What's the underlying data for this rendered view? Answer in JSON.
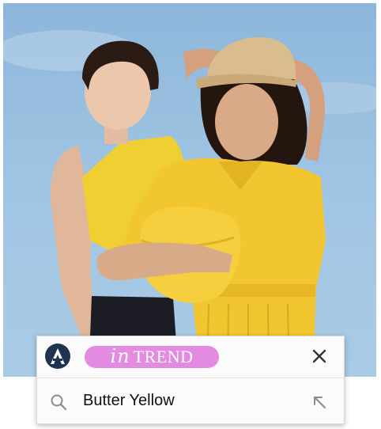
{
  "photo": {
    "subject": "two-models-yellow-outfits",
    "colors": {
      "sky": "#9fc4e3",
      "outfit": "#f2c630",
      "cap": "#d8b98a",
      "hair": "#2b1a12"
    }
  },
  "search_card": {
    "logo_icon": "a-logo-icon",
    "trend_badge": {
      "prefix": "in",
      "word": "TREND",
      "color": "#e38be0"
    },
    "close_icon": "close-icon",
    "query": "Butter Yellow",
    "search_icon": "search-icon",
    "arrow_icon": "arrow-up-left-icon"
  }
}
